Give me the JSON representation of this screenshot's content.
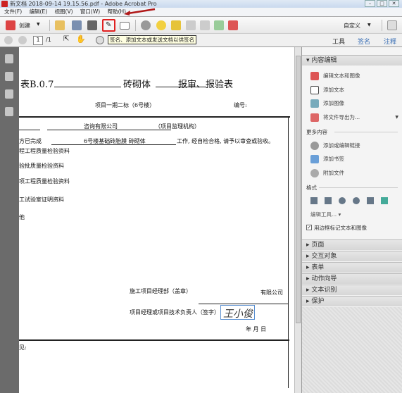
{
  "window": {
    "title": "新文档 2018-09-14 19.15.56.pdf - Adobe Acrobat Pro",
    "minimize": "–",
    "maximize": "□",
    "close": "✕"
  },
  "menu": [
    "文件(F)",
    "编辑(E)",
    "视图(V)",
    "窗口(W)",
    "帮助(H)"
  ],
  "toolbar": {
    "create": "创建",
    "customize": "自定义",
    "page_current": "1",
    "page_total": "/1",
    "tooltip": "签名、添加文本或发送文档以供签名",
    "tabs": [
      "工具",
      "签名",
      "注释"
    ]
  },
  "colors": {
    "highlight": "#e02020",
    "accent": "#3a6fb5"
  },
  "document": {
    "title_prefix": "表B.0.7",
    "title_middle": "砖砌体",
    "title_suffix": "报审、报验表",
    "project": "项目一期二标（6号楼）",
    "number_label": "编号:",
    "company": "咨询有限公司",
    "supervisor": "（项目监理机构）",
    "completed_prefix": "方已完成",
    "work_item": "6号楼基础砖胎膜 砖砌体",
    "completed_suffix": "工作, 经自检合格, 请予以审查或验收。",
    "attachments": [
      "程工程质量检验资料",
      "验批质量检验资料",
      "项工程质量检验资料",
      "工试验室证明资料",
      "他"
    ],
    "dept": "施工项目经理部（盖章）",
    "company2": "有限公司",
    "manager": "项目经理或项目技术负责人（签字）",
    "signature": "王小俊",
    "date": "年   月   日",
    "opinion": "见:"
  },
  "panel": {
    "content_edit": "内容编辑",
    "items": [
      "编辑文本和图像",
      "添加文本",
      "添加图像",
      "将文件导出为..."
    ],
    "more_content": "更多内容",
    "more_items": [
      "添加或编辑链接",
      "添加书签",
      "附加文件"
    ],
    "format": "格式",
    "edit_tools": "编辑工具...",
    "checkbox_label": "用边框标记文本和图像",
    "checkbox_checked": true,
    "sections": [
      "页面",
      "交互对象",
      "表单",
      "动作向导",
      "文本识别",
      "保护"
    ]
  }
}
